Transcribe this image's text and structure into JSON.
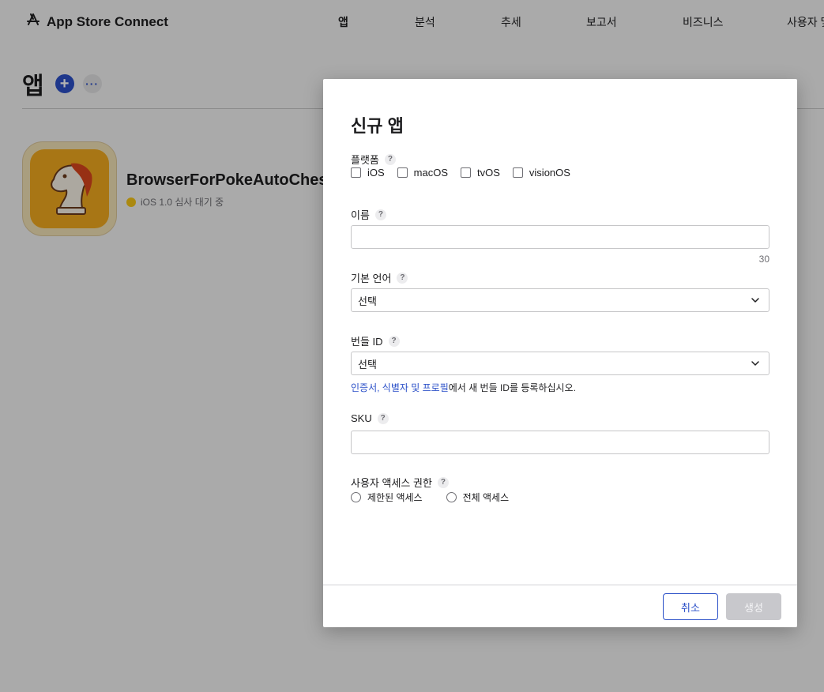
{
  "header": {
    "app_name": "App Store Connect",
    "nav": [
      "앱",
      "분석",
      "추세",
      "보고서",
      "비즈니스",
      "사용자 및"
    ]
  },
  "page": {
    "title": "앱",
    "add_icon": "+",
    "more_icon": "···"
  },
  "app": {
    "name": "BrowserForPokeAutoChes",
    "status": "iOS 1.0 심사 대기 중",
    "status_color": "#f5c518",
    "icon_bg": "#f1aa1f"
  },
  "modal": {
    "title": "신규 앱",
    "platform_label": "플랫폼",
    "platforms": [
      "iOS",
      "macOS",
      "tvOS",
      "visionOS"
    ],
    "name_label": "이름",
    "name_value": "",
    "name_char_count": "30",
    "language_label": "기본 언어",
    "language_value": "선택",
    "bundle_label": "번들 ID",
    "bundle_value": "선택",
    "bundle_help_link": "인증서, 식별자 및 프로필",
    "bundle_help_rest": "에서 새 번들 ID를 등록하십시오.",
    "sku_label": "SKU",
    "sku_value": "",
    "access_label": "사용자 액세스 권한",
    "access_options": [
      "제한된 액세스",
      "전체 액세스"
    ],
    "help_icon": "?",
    "cancel_label": "취소",
    "create_label": "생성"
  },
  "colors": {
    "accent": "#2b50c8",
    "disabled_button": "#c8c8cc"
  }
}
